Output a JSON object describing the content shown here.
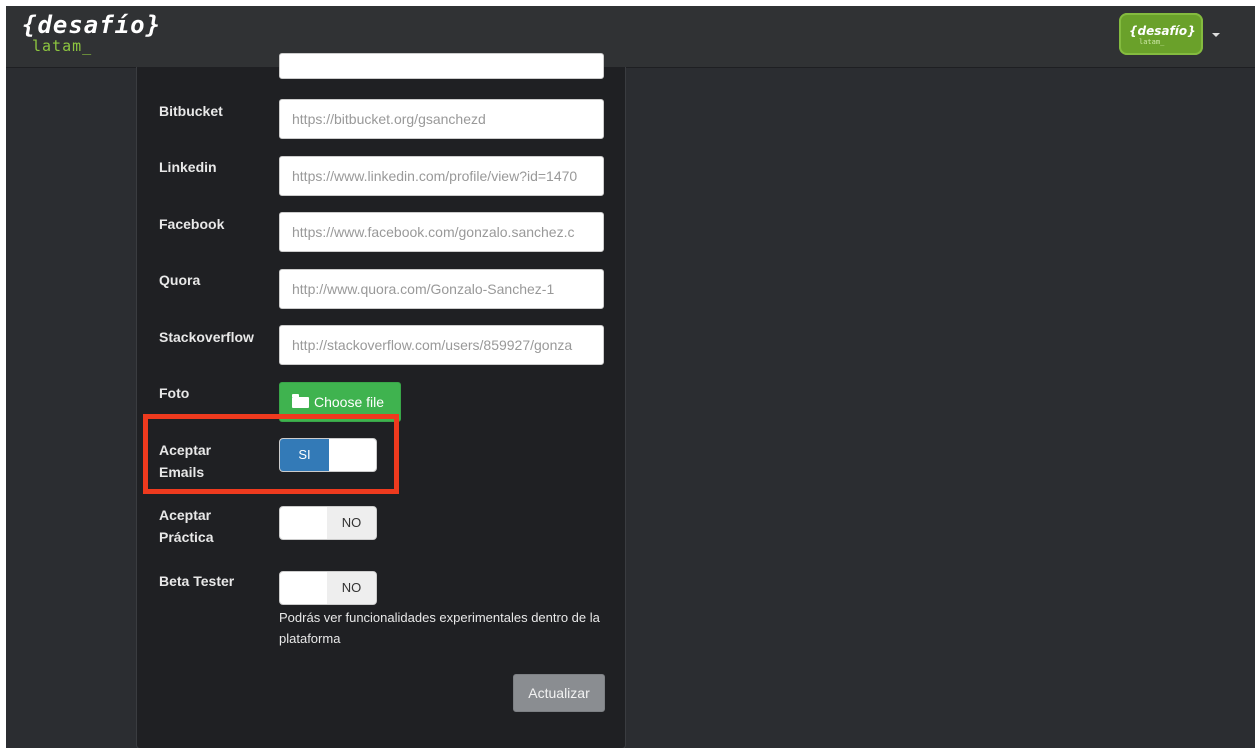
{
  "header": {
    "logo_main": "{desafío}",
    "logo_sub": "latam_",
    "avatar_main": "{desafío}",
    "avatar_sub": "latam_"
  },
  "form": {
    "fields": [
      {
        "label": "Bitbucket",
        "value": "https://bitbucket.org/gsanchezd"
      },
      {
        "label": "Linkedin",
        "value": "https://www.linkedin.com/profile/view?id=1470"
      },
      {
        "label": "Facebook",
        "value": "https://www.facebook.com/gonzalo.sanchez.c"
      },
      {
        "label": "Quora",
        "value": "http://www.quora.com/Gonzalo-Sanchez-1"
      },
      {
        "label": "Stackoverflow",
        "value": "http://stackoverflow.com/users/859927/gonza"
      }
    ],
    "foto": {
      "label": "Foto",
      "button": "Choose file"
    },
    "aceptar_emails": {
      "label_line1": "Aceptar",
      "label_line2": "Emails",
      "state": "SI"
    },
    "aceptar_practica": {
      "label_line1": "Aceptar",
      "label_line2": "Práctica",
      "state": "NO"
    },
    "beta_tester": {
      "label": "Beta Tester",
      "state": "NO",
      "help": "Podrás ver funcionalidades experimentales dentro de la plataforma"
    },
    "submit": "Actualizar"
  },
  "colors": {
    "background": "#2b2d31",
    "panel": "#1f2023",
    "switch_on": "#337ab7",
    "file_button": "#3fb34f",
    "highlight": "#ee3a1e",
    "logo_accent": "#8dc63f"
  }
}
